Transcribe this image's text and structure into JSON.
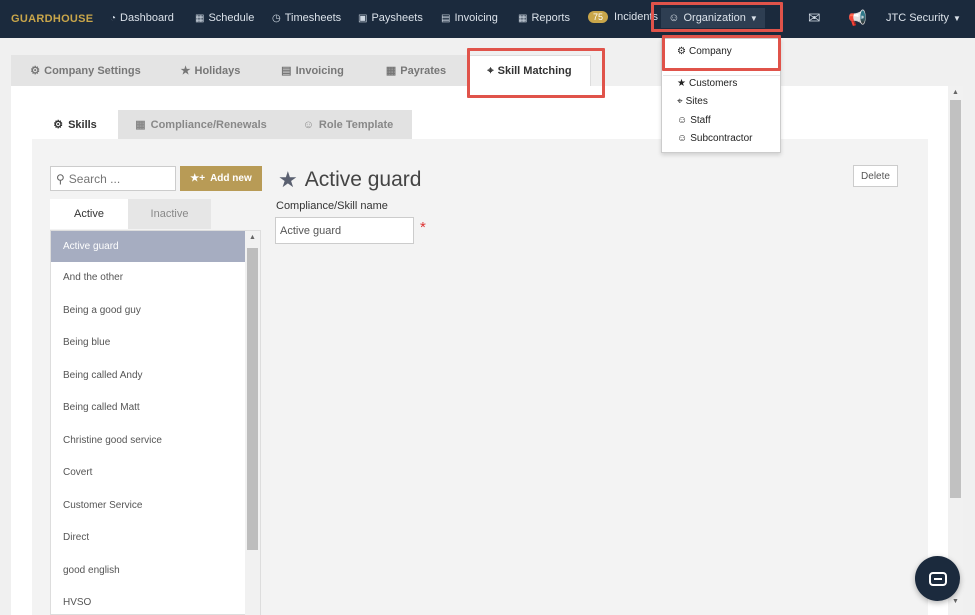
{
  "nav": {
    "logo": "GUARDHOUSE",
    "items": [
      {
        "label": "Dashboard",
        "icon": "dashboard-icon",
        "glyph": "◔"
      },
      {
        "label": "Schedule",
        "icon": "calendar-icon",
        "glyph": "▦"
      },
      {
        "label": "Timesheets",
        "icon": "clock-icon",
        "glyph": "◷"
      },
      {
        "label": "Paysheets",
        "icon": "money-icon",
        "glyph": "▣"
      },
      {
        "label": "Invoicing",
        "icon": "invoice-icon",
        "glyph": "▤"
      },
      {
        "label": "Reports",
        "icon": "table-icon",
        "glyph": "▦"
      }
    ],
    "incidents_badge": "75",
    "incidents_label": "Incidents",
    "organization_label": "Organization",
    "account_label": "JTC Security"
  },
  "org_dropdown": {
    "items": [
      {
        "label": "Company",
        "icon": "gear-icon",
        "glyph": "⚙"
      },
      {
        "label": "Customers",
        "icon": "star-icon",
        "glyph": "★"
      },
      {
        "label": "Sites",
        "icon": "map-marker-icon",
        "glyph": "⌖"
      },
      {
        "label": "Staff",
        "icon": "user-icon",
        "glyph": "☺"
      },
      {
        "label": "Subcontractor",
        "icon": "user-icon",
        "glyph": "☺"
      }
    ]
  },
  "settings_tabs": [
    {
      "label": "Company Settings",
      "glyph": "⚙"
    },
    {
      "label": "Holidays",
      "glyph": "★"
    },
    {
      "label": "Invoicing",
      "glyph": "▤"
    },
    {
      "label": "Payrates",
      "glyph": "▦"
    },
    {
      "label": "Skill Matching",
      "glyph": "⌖"
    }
  ],
  "sub_tabs": [
    {
      "label": "Skills",
      "glyph": "⚙"
    },
    {
      "label": "Compliance/Renewals",
      "glyph": "▦"
    },
    {
      "label": "Role Template",
      "glyph": "☺"
    }
  ],
  "search": {
    "placeholder": "Search ..."
  },
  "add_new_label": "Add new",
  "status_tabs": [
    "Active",
    "Inactive"
  ],
  "skills": [
    "Active guard",
    "And the other",
    "Being a good guy",
    "Being blue",
    "Being called Andy",
    "Being called Matt",
    "Christine good service",
    "Covert",
    "Customer Service",
    "Direct",
    "good english",
    "HVSO"
  ],
  "detail": {
    "title": "Active guard",
    "field_label": "Compliance/Skill name",
    "field_value": "Active guard",
    "required_mark": "*",
    "delete_label": "Delete"
  },
  "colors": {
    "nav_bg": "#1b2a3d",
    "brand_gold": "#c9a64a",
    "add_button": "#b89b56",
    "selected_row": "#a6adc1",
    "highlight": "#e0534a"
  }
}
